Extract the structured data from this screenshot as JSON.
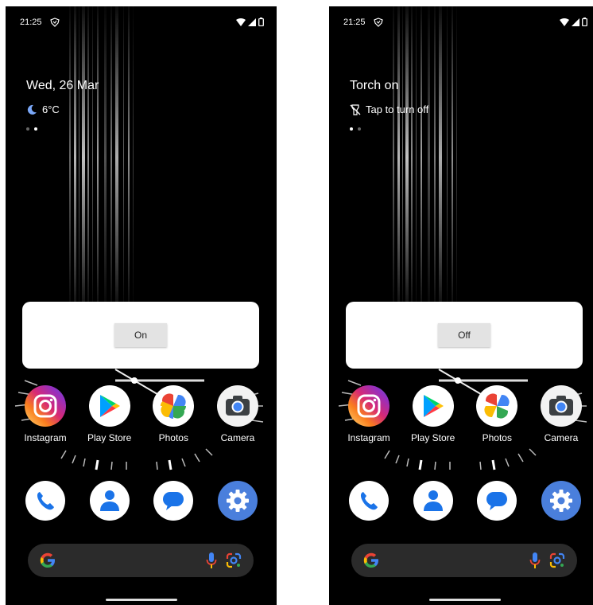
{
  "screens": [
    {
      "status": {
        "time": "21:25"
      },
      "widget": {
        "title": "Wed, 26 Mar",
        "subtitle": "6°C",
        "subtitle_icon": "moon-icon"
      },
      "dialog": {
        "button_label": "On"
      },
      "apps": [
        {
          "label": "Instagram",
          "icon": "instagram-icon"
        },
        {
          "label": "Play Store",
          "icon": "play-store-icon"
        },
        {
          "label": "Photos",
          "icon": "photos-icon"
        },
        {
          "label": "Camera",
          "icon": "camera-icon"
        }
      ],
      "dock": [
        "phone-icon",
        "contacts-icon",
        "messages-icon",
        "settings-icon"
      ]
    },
    {
      "status": {
        "time": "21:25"
      },
      "widget": {
        "title": "Torch on",
        "subtitle": "Tap to turn off",
        "subtitle_icon": "flashlight-off-icon"
      },
      "dialog": {
        "button_label": "Off"
      },
      "apps": [
        {
          "label": "Instagram",
          "icon": "instagram-icon"
        },
        {
          "label": "Play Store",
          "icon": "play-store-icon"
        },
        {
          "label": "Photos",
          "icon": "photos-icon"
        },
        {
          "label": "Camera",
          "icon": "camera-icon"
        }
      ],
      "dock": [
        "phone-icon",
        "contacts-icon",
        "messages-icon",
        "settings-icon"
      ]
    }
  ],
  "colors": {
    "search_bar": "#2b2b2b",
    "settings_blue": "#4a7fdc",
    "dialog_button": "#e3e3e3"
  }
}
